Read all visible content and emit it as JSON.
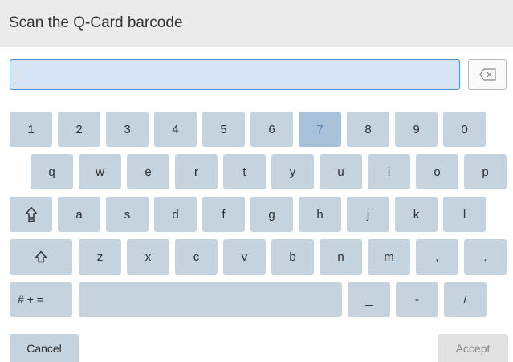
{
  "header": {
    "title": "Scan the Q-Card barcode"
  },
  "input": {
    "value": ""
  },
  "keyboard": {
    "row1": [
      "1",
      "2",
      "3",
      "4",
      "5",
      "6",
      "7",
      "8",
      "9",
      "0"
    ],
    "row2": [
      "q",
      "w",
      "e",
      "r",
      "t",
      "y",
      "u",
      "i",
      "o",
      "p"
    ],
    "row3": [
      "a",
      "s",
      "d",
      "f",
      "g",
      "h",
      "j",
      "k",
      "l"
    ],
    "row4": [
      "z",
      "x",
      "c",
      "v",
      "b",
      "n",
      "m",
      ",",
      "."
    ],
    "symbols_label": "# + =",
    "row5": [
      "_",
      "-",
      "/"
    ],
    "pressed_key": "7",
    "icons": {
      "backspace": "backspace-icon",
      "caps_lock": "caps-lock-icon",
      "shift": "shift-icon"
    }
  },
  "actions": {
    "cancel_label": "Cancel",
    "accept_label": "Accept"
  },
  "colors": {
    "key": "#c5d3de",
    "key_pressed": "#a9c1d8",
    "input_bg": "#d6e4f5",
    "input_border": "#4d8ed8",
    "header_bg": "#ebebeb"
  }
}
